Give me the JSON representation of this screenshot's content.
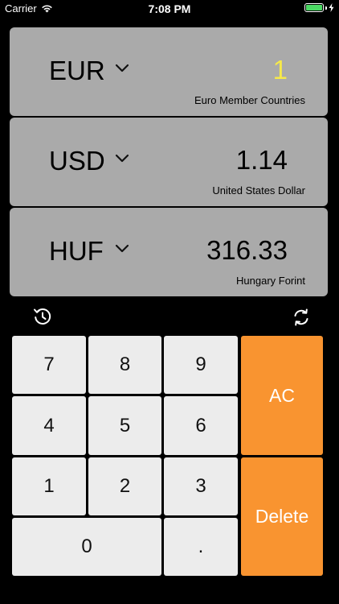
{
  "status_bar": {
    "carrier": "Carrier",
    "time": "7:08 PM",
    "battery_color": "#4cd964"
  },
  "currencies": [
    {
      "code": "EUR",
      "value": "1",
      "name": "Euro Member Countries",
      "active": true
    },
    {
      "code": "USD",
      "value": "1.14",
      "name": "United States Dollar",
      "active": false
    },
    {
      "code": "HUF",
      "value": "316.33",
      "name": "Hungary Forint",
      "active": false
    }
  ],
  "tools": {
    "history_icon": "history-icon",
    "swap_icon": "refresh-icon"
  },
  "keypad": {
    "k7": "7",
    "k8": "8",
    "k9": "9",
    "k4": "4",
    "k5": "5",
    "k6": "6",
    "k1": "1",
    "k2": "2",
    "k3": "3",
    "k0": "0",
    "kdot": ".",
    "clear": "AC",
    "delete": "Delete"
  },
  "colors": {
    "background": "#000000",
    "card": "#aaaaaa",
    "active_value": "#f6e94a",
    "key": "#ececec",
    "accent": "#f99430"
  }
}
